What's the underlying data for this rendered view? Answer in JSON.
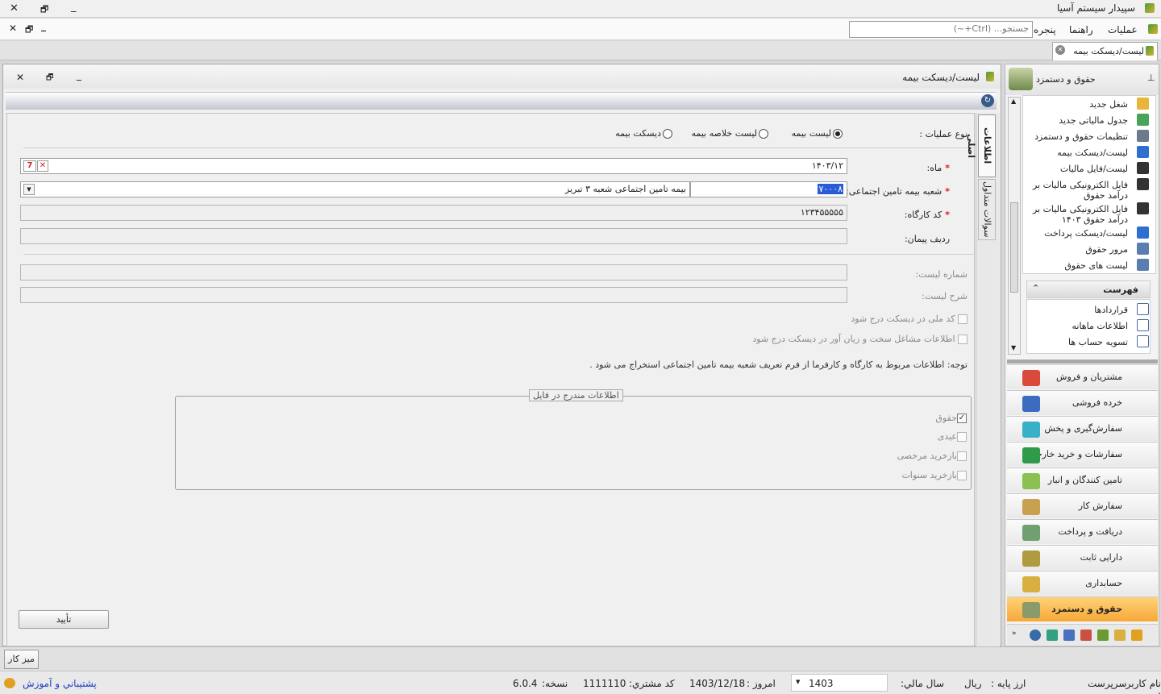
{
  "app": {
    "title": "سپیدار سیستم آسیا"
  },
  "menu": {
    "items": [
      "عملیات",
      "راهنما",
      "پنجره"
    ],
    "search_placeholder": "جستجو... (Ctrl+~)"
  },
  "tabs": {
    "active": "لیست/دیسکت بیمه"
  },
  "window": {
    "title": "لیست/دیسکت بیمه"
  },
  "vtabs": [
    "اطلاعات اصلی",
    "سوالات متداول"
  ],
  "form": {
    "op_label": "نوع عملیات :",
    "op_options": [
      "لیست بیمه",
      "لیست خلاصه بیمه",
      "دیسکت بیمه"
    ],
    "op_selected": 0,
    "month_label": "ماه:",
    "month_value": "۱۴۰۳/۱۲",
    "branch_label": "شعبه بیمه تامین اجتماعی:",
    "branch_code": "۷۰۰۰۸",
    "branch_name": "بیمه تامین اجتماعی شعبه ۳ تبریز",
    "workshop_label": "کد کارگاه:",
    "workshop_value": "۱۲۳۴۵۵۵۵۵",
    "contract_label": "ردیف پیمان:",
    "list_no_label": "شماره لیست:",
    "list_desc_label": "شرح لیست:",
    "chk_national": "کد ملی در دیسکت درج شود",
    "chk_hard_jobs": "اطلاعات مشاغل سخت و زیان آور در دیسکت درج شود",
    "note": "توجه: اطلاعات مربوط به کارگاه و کارفرما از فرم تعریف شعبه بیمه تامین اجتماعی استخراج می شود .",
    "group_title": "اطلاعات مندرج در فایل",
    "group_items": [
      {
        "label": "حقوق",
        "checked": true
      },
      {
        "label": "عیدی",
        "checked": false
      },
      {
        "label": "بازخرید مرخصی",
        "checked": false
      },
      {
        "label": "بازخرید سنوات",
        "checked": false
      }
    ],
    "confirm": "تأیید"
  },
  "sidebar": {
    "header": "حقوق و دستمزد",
    "tree": [
      {
        "label": "شغل جدید",
        "color": "#e9b43a"
      },
      {
        "label": "جدول مالیاتی جدید",
        "color": "#4aa35a"
      },
      {
        "label": "تنظیمات حقوق و دستمزد",
        "color": "#6b7b8c"
      },
      {
        "label": "لیست/دیسکت بیمه",
        "color": "#2f6fd0"
      },
      {
        "label": "لیست/فایل مالیات",
        "color": "#333333"
      },
      {
        "label": "فایل الکترونیکی مالیات بر درآمد حقوق",
        "color": "#333333"
      },
      {
        "label": "فایل الکترونیکی مالیات بر درآمد حقوق ۱۴۰۳",
        "color": "#333333"
      },
      {
        "label": "لیست/دیسکت پرداخت",
        "color": "#2f6fd0"
      },
      {
        "label": "مرور حقوق",
        "color": "#5b7db0"
      },
      {
        "label": "لیست های حقوق",
        "color": "#5b7db0"
      }
    ],
    "section2": "فهرست",
    "tree2": [
      "قراردادها",
      "اطلاعات ماهانه",
      "تسویه حساب ها"
    ],
    "modules": [
      {
        "label": "مشتریان و فروش",
        "color": "#d94a3a"
      },
      {
        "label": "خرده فروشی",
        "color": "#3c6cc0"
      },
      {
        "label": "سفارش‌گیری و پخش",
        "color": "#38b0c8"
      },
      {
        "label": "سفارشات و خرید خارجی",
        "color": "#2f9a4a"
      },
      {
        "label": "تامین کنندگان و انبار",
        "color": "#8cc050"
      },
      {
        "label": "سفارش کار",
        "color": "#c8a050"
      },
      {
        "label": "دریافت و پرداخت",
        "color": "#70a070"
      },
      {
        "label": "دارایی ثابت",
        "color": "#b09a40"
      },
      {
        "label": "حسابداری",
        "color": "#d8b040"
      },
      {
        "label": "حقوق و دستمزد",
        "color": "#8a9a6a"
      }
    ]
  },
  "desktop_button": "میز کار",
  "status": {
    "user_label": "نام کاربر :",
    "user": "سرپرست",
    "currency_label": "ارز پایه :",
    "currency": "ریال",
    "fy_label": "سال مالي:",
    "fy": "1403",
    "today_label": "امروز :",
    "today": "1403/12/18",
    "cust_label": "کد مشتري:",
    "cust": "1111110",
    "ver_label": "نسخه:",
    "ver": "6.0.4",
    "support": "پشتيباني و آموزش"
  }
}
